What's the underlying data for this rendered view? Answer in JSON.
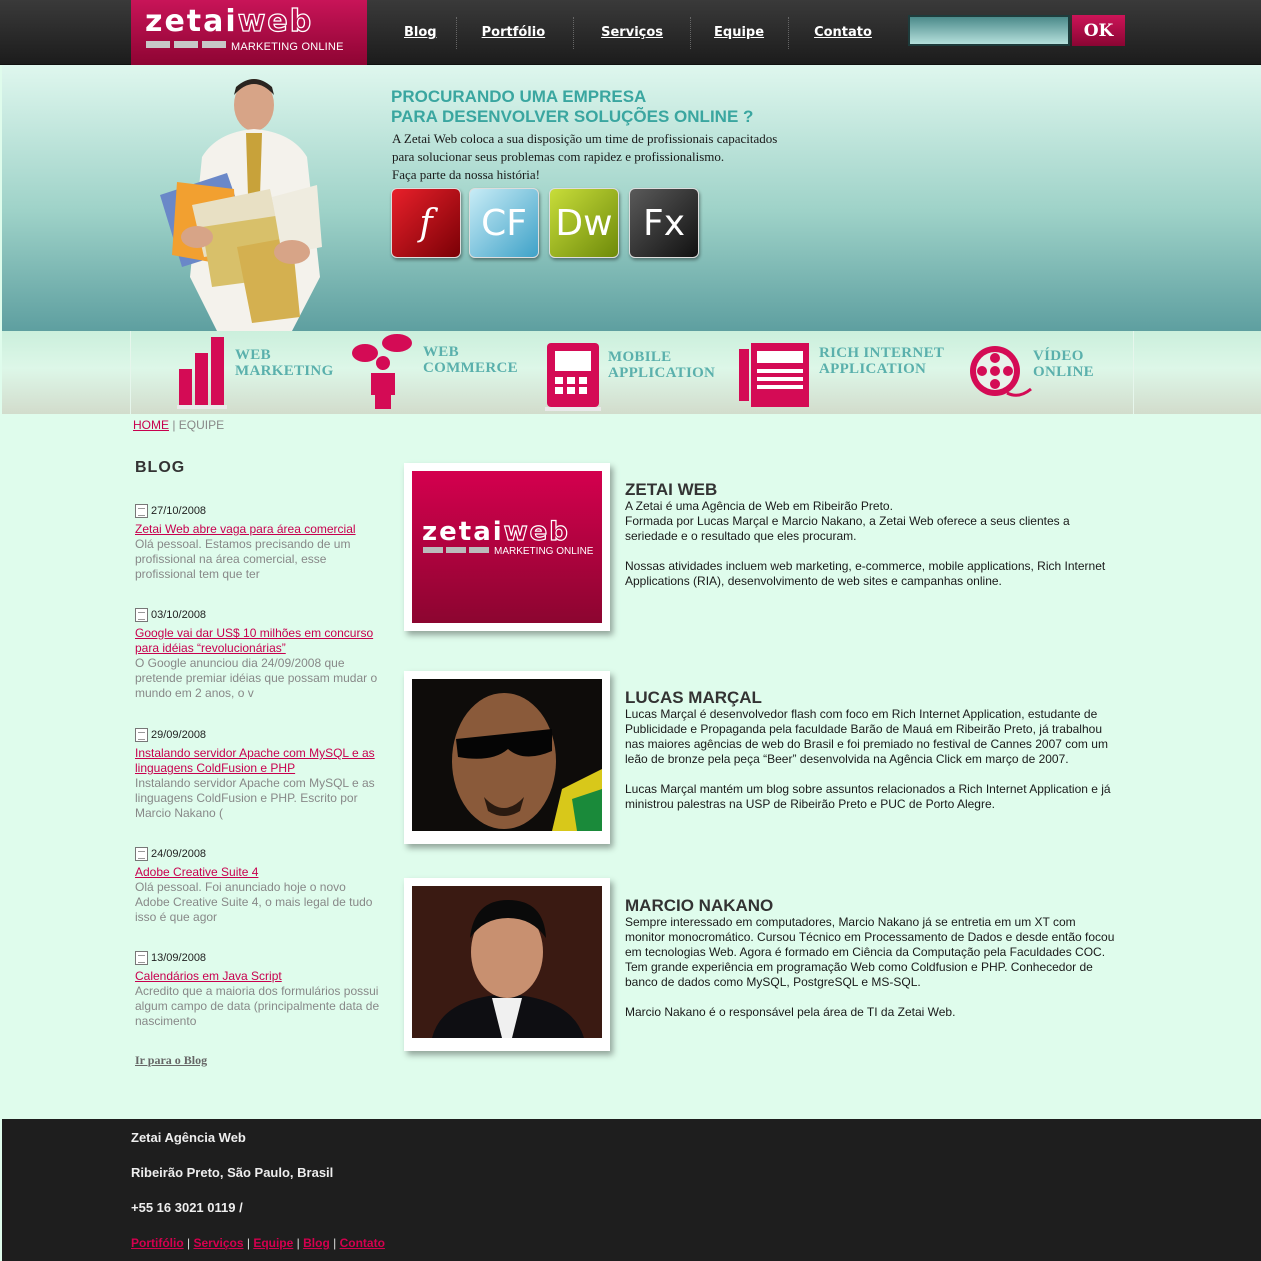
{
  "header": {
    "logo_word_1": "zetai",
    "logo_word_2": "web",
    "logo_sub": "MARKETING ONLINE",
    "nav": [
      "Blog",
      "Portfólio",
      "Serviços",
      "Equipe",
      "Contato"
    ],
    "search_value": "",
    "search_button": "OK"
  },
  "hero": {
    "title_line1": "PROCURANDO UMA EMPRESA",
    "title_line2": "PARA DESENVOLVER SOLUÇÕES ONLINE ?",
    "text_line1": "A Zetai Web coloca a sua disposição um time de profissionais capacitados",
    "text_line2": "para solucionar seus problemas com rapidez e profissionalismo.",
    "text_line3": "Faça parte da nossa história!",
    "products": [
      {
        "icon": "flash-icon",
        "label": "f"
      },
      {
        "icon": "coldfusion-icon",
        "label": "CF"
      },
      {
        "icon": "dreamweaver-icon",
        "label": "Dw"
      },
      {
        "icon": "flex-icon",
        "label": "Fx"
      }
    ]
  },
  "services": [
    {
      "icon": "bar-chart-icon",
      "line1": "WEB",
      "line2": "MARKETING"
    },
    {
      "icon": "person-speech-icon",
      "line1": "WEB",
      "line2": "COMMERCE"
    },
    {
      "icon": "mobile-phone-icon",
      "line1": "MOBILE",
      "line2": "APPLICATION"
    },
    {
      "icon": "browser-window-icon",
      "line1": "RICH INTERNET",
      "line2": "APPLICATION"
    },
    {
      "icon": "film-reel-icon",
      "line1": "VÍDEO",
      "line2": "ONLINE"
    }
  ],
  "breadcrumb": {
    "home": "HOME",
    "separator": " | ",
    "current": "EQUIPE"
  },
  "blog": {
    "title": "BLOG",
    "posts": [
      {
        "date": "27/10/2008",
        "title": "Zetai Web abre vaga para área comercial",
        "excerpt": "Olá pessoal. Estamos precisando de um profissional na área comercial, esse profissional tem que ter"
      },
      {
        "date": "03/10/2008",
        "title": "Google vai dar US$ 10 milhões em concurso para idéias “revolucionárias”",
        "excerpt": "O Google anunciou dia 24/09/2008 que pretende premiar idéias que possam mudar o mundo em 2 anos, o v"
      },
      {
        "date": "29/09/2008",
        "title": "Instalando servidor Apache com MySQL e as linguagens ColdFusion e PHP",
        "excerpt": "Instalando servidor Apache com MySQL e as linguagens ColdFusion e PHP. Escrito por Marcio Nakano ("
      },
      {
        "date": "24/09/2008",
        "title": "Adobe Creative Suite 4",
        "excerpt": "Olá pessoal. Foi anunciado hoje o novo Adobe Creative Suite 4, o mais legal de tudo isso é que agor"
      },
      {
        "date": "13/09/2008",
        "title": "Calendários em Java Script",
        "excerpt": "Acredito que a maioria dos formulários possui algum campo de data (principalmente data de nascimento"
      }
    ],
    "more": "Ir para o Blog"
  },
  "team": [
    {
      "name": "ZETAI WEB",
      "p1": "A Zetai é uma Agência de Web em Ribeirão Preto.\nFormada por Lucas Marçal e Marcio Nakano, a Zetai Web oferece a seus clientes a seriedade e o resultado que eles procuram.",
      "p2": "Nossas atividades incluem web marketing, e-commerce, mobile applications, Rich Internet Applications (RIA), desenvolvimento de web sites e campanhas online."
    },
    {
      "name": "LUCAS MARÇAL",
      "p1": "Lucas Marçal é desenvolvedor flash com foco em Rich Internet Application, estudante de Publicidade e Propaganda pela faculdade Barão de Mauá em Ribeirão Preto, já trabalhou nas maiores agências de web do Brasil e foi premiado no festival de Cannes 2007 com um leão de bronze pela peça “Beer” desenvolvida na Agência Click em março de 2007.",
      "p2": "Lucas Marçal mantém um blog sobre assuntos relacionados a Rich Internet Application e já ministrou palestras na USP de Ribeirão Preto e PUC de Porto Alegre."
    },
    {
      "name": "MARCIO NAKANO",
      "p1": "Sempre interessado em computadores, Marcio Nakano já se entretia em um XT com monitor monocromático. Cursou Técnico em Processamento de Dados e desde então focou em tecnologias Web. Agora é formado em Ciência da Computação pela Faculdades COC. Tem grande experiência em programação Web como Coldfusion e PHP. Conhecedor de banco de dados como MySQL, PostgreSQL e MS-SQL.",
      "p2": "Marcio Nakano é o responsável pela área de TI da Zetai Web."
    }
  ],
  "footer": {
    "company": "Zetai Agência Web",
    "location": "Ribeirão Preto, São Paulo, Brasil",
    "phone": "+55 16 3021 0119 /",
    "links": [
      "Portifólio",
      "Serviços",
      "Equipe",
      "Blog",
      "Contato"
    ],
    "separator": " | "
  },
  "colors": {
    "brand": "#c8004e",
    "teal": "#3aa6a0",
    "background": "#dffcec",
    "footer": "#1e1e1e"
  }
}
